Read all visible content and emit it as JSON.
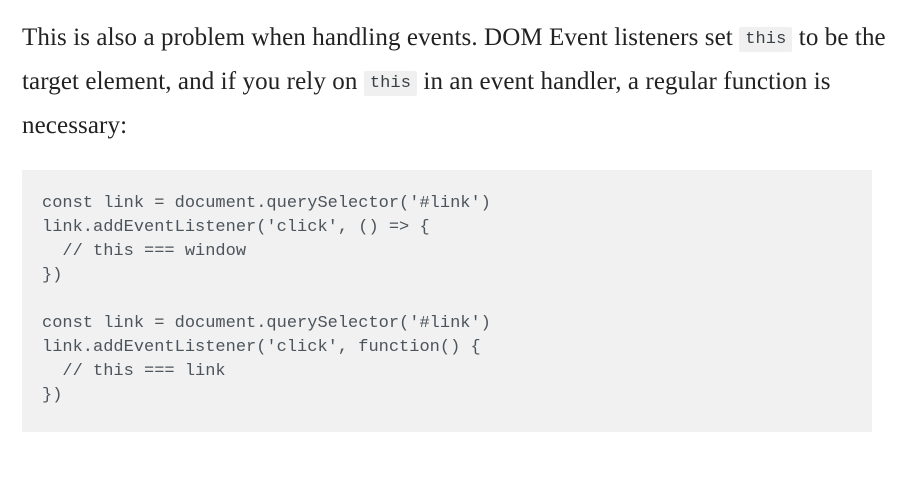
{
  "document": {
    "paragraph": {
      "segment_1": "This is also a problem when handling events. DOM Event listeners set ",
      "inline_code_1": "this",
      "segment_2": " to be the target element, and if you rely on ",
      "inline_code_2": "this",
      "segment_3": " in an event handler, a regular function is necessary:"
    },
    "code_block": {
      "language": "javascript",
      "content": "const link = document.querySelector('#link')\nlink.addEventListener('click', () => {\n  // this === window\n})\n\nconst link = document.querySelector('#link')\nlink.addEventListener('click', function() {\n  // this === link\n})"
    }
  },
  "colors": {
    "page_background": "#ffffff",
    "body_text": "#222222",
    "code_block_background": "#f1f1f1",
    "code_text": "#4c545c",
    "inline_code_background": "#f0f0f0",
    "inline_code_text": "#3a3f44"
  }
}
